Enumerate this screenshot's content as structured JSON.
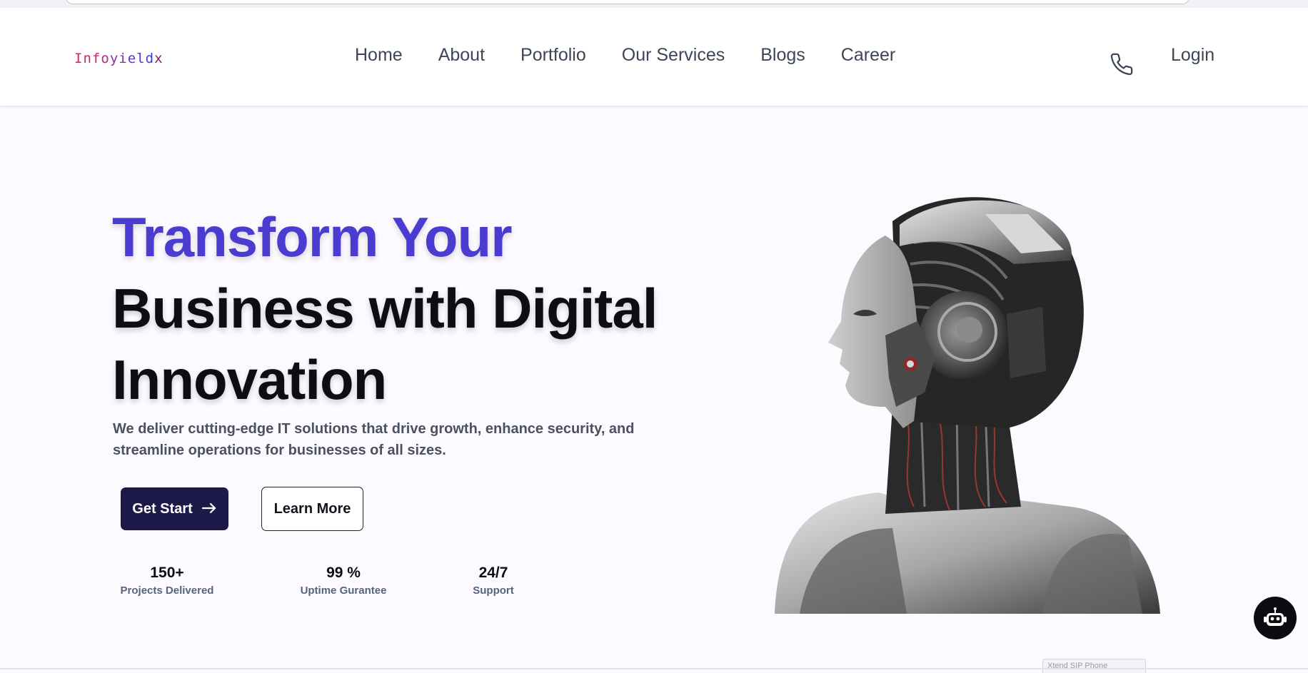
{
  "brand": {
    "logo_text": "Infoyieldx"
  },
  "nav": {
    "items": [
      "Home",
      "About",
      "Portfolio",
      "Our Services",
      "Blogs",
      "Career"
    ],
    "phone_icon": "phone-icon",
    "login_label": "Login"
  },
  "hero": {
    "title_line1": "Transform Your",
    "title_line2": "Business with Digital",
    "title_line3": "Innovation",
    "description": "We deliver cutting-edge IT solutions that drive growth, enhance security, and streamline operations for businesses of all sizes.",
    "primary_button": "Get Start",
    "primary_button_icon": "arrow-right-icon",
    "secondary_button": "Learn More",
    "image": "humanoid-robot-illustration"
  },
  "stats": [
    {
      "value": "150+",
      "label": "Projects Delivered"
    },
    {
      "value": "99 %",
      "label": "Uptime Gurantee"
    },
    {
      "value": "24/7",
      "label": "Support"
    }
  ],
  "widgets": {
    "chatbot_icon": "robot-chat-icon",
    "sip_tab_label": "Xtend SIP Phone"
  },
  "colors": {
    "accent": "#4a3bd1",
    "primary_button": "#1d1a4a",
    "text_dark": "#0d0d12",
    "nav_text": "#3c4656",
    "background": "#fcfaff"
  }
}
